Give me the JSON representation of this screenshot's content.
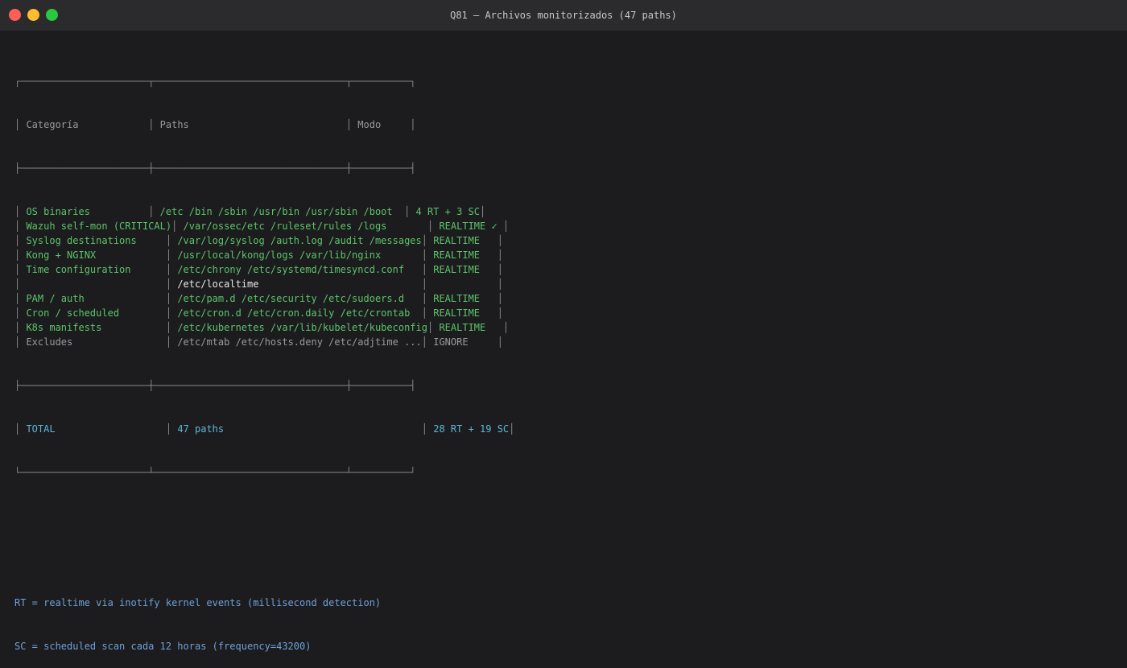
{
  "window": {
    "title": "Q81 — Archivos monitorizados (47 paths)"
  },
  "table": {
    "top_border": "┌──────────────────────┬─────────────────────────────────┬──────────┐",
    "header": {
      "categoria": " Categoría            ",
      "paths": " Paths                           ",
      "modo": " Modo     "
    },
    "header_sep": "├──────────────────────┼─────────────────────────────────┼──────────┤",
    "rows": [
      {
        "categoria": " OS binaries          ",
        "paths": " /etc /bin /sbin /usr/bin /usr/sbin /boot  ",
        "modo": " 4 RT + 3 SC",
        "style": "g"
      },
      {
        "categoria": " Wazuh self-mon (CRITICAL)",
        "paths": " /var/ossec/etc /ruleset/rules /logs       ",
        "modo": " REALTIME ✓ ",
        "style": "g"
      },
      {
        "categoria": " Syslog destinations     ",
        "paths": " /var/log/syslog /auth.log /audit /messages",
        "modo": " REALTIME   ",
        "style": "g"
      },
      {
        "categoria": " Kong + NGINX            ",
        "paths": " /usr/local/kong/logs /var/lib/nginx       ",
        "modo": " REALTIME   ",
        "style": "g"
      },
      {
        "categoria": " Time configuration      ",
        "paths": " /etc/chrony /etc/systemd/timesyncd.conf   ",
        "modo": " REALTIME   ",
        "style": "g"
      },
      {
        "categoria": "                         ",
        "paths": " /etc/localtime                            ",
        "modo": "            ",
        "style": "w"
      },
      {
        "categoria": " PAM / auth              ",
        "paths": " /etc/pam.d /etc/security /etc/sudoers.d   ",
        "modo": " REALTIME   ",
        "style": "g"
      },
      {
        "categoria": " Cron / scheduled        ",
        "paths": " /etc/cron.d /etc/cron.daily /etc/crontab  ",
        "modo": " REALTIME   ",
        "style": "g"
      },
      {
        "categoria": " K8s manifests           ",
        "paths": " /etc/kubernetes /var/lib/kubelet/kubeconfig",
        "modo": " REALTIME   ",
        "style": "g"
      },
      {
        "categoria": " Excludes                ",
        "paths": " /etc/mtab /etc/hosts.deny /etc/adjtime ...",
        "modo": " IGNORE     ",
        "style": "x"
      }
    ],
    "total_sep": "├──────────────────────┼─────────────────────────────────┼──────────┤",
    "total": {
      "categoria": " TOTAL                   ",
      "paths": " 47 paths                                  ",
      "modo": " 28 RT + 19 SC"
    },
    "bottom_border": "└──────────────────────┴─────────────────────────────────┴──────────┘"
  },
  "notes": [
    "RT = realtime via inotify kernel events (millisecond detection)",
    "SC = scheduled scan cada 12 horas (frequency=43200)"
  ],
  "colors": {
    "green": "#5cc46a",
    "cyan": "#5bb7d8",
    "note_blue": "#6fa0d8"
  }
}
